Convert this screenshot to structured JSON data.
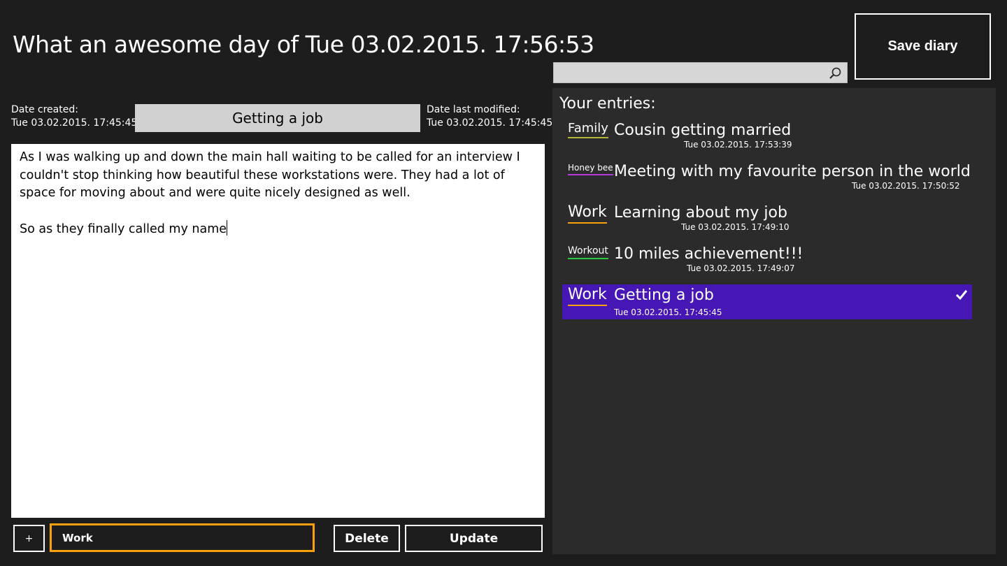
{
  "header": {
    "title": "What an awesome day of Tue 03.02.2015. 17:56:53",
    "save_label": "Save diary"
  },
  "search": {
    "value": "",
    "placeholder": ""
  },
  "entry_editor": {
    "date_created_label": "Date created:",
    "date_created_value": "Tue 03.02.2015. 17:45:45",
    "title": "Getting a job",
    "date_modified_label": "Date last modified:",
    "date_modified_value": "Tue 03.02.2015. 17:45:45",
    "body_paragraph_1": "As I was walking up and down the main hall waiting to be called for an interview I couldn't stop thinking how beautiful these workstations were. They had a lot of space for moving about and were quite nicely designed as well.",
    "body_paragraph_2": "So as they finally called my name"
  },
  "footer": {
    "plus_label": "+",
    "category_value": "Work",
    "delete_label": "Delete",
    "update_label": "Update"
  },
  "entries_panel": {
    "heading": "Your entries:",
    "entries": [
      {
        "tag": "Family",
        "tag_color": "#b8b43a",
        "title": "Cousin getting married",
        "date": "Tue 03.02.2015. 17:53:39",
        "selected": false
      },
      {
        "tag": "Honey bee",
        "tag_color": "#b33ad6",
        "title": "Meeting with my favourite person in the world",
        "date": "Tue 03.02.2015. 17:50:52",
        "selected": false
      },
      {
        "tag": "Work",
        "tag_color": "#f7a20d",
        "title": "Learning about my job",
        "date": "Tue 03.02.2015. 17:49:10",
        "selected": false
      },
      {
        "tag": "Workout",
        "tag_color": "#27c93f",
        "title": "10 miles achievement!!!",
        "date": "Tue 03.02.2015. 17:49:07",
        "selected": false
      },
      {
        "tag": "Work",
        "tag_color": "#f7a20d",
        "title": "Getting a job",
        "date": "Tue 03.02.2015. 17:45:45",
        "selected": true
      }
    ]
  },
  "colors": {
    "background": "#1d1d1d",
    "panel": "#2b2b2b",
    "selection": "#4617b4",
    "accent_orange": "#f7a20d"
  },
  "icons": {
    "search": "search-icon",
    "check": "check-icon"
  }
}
